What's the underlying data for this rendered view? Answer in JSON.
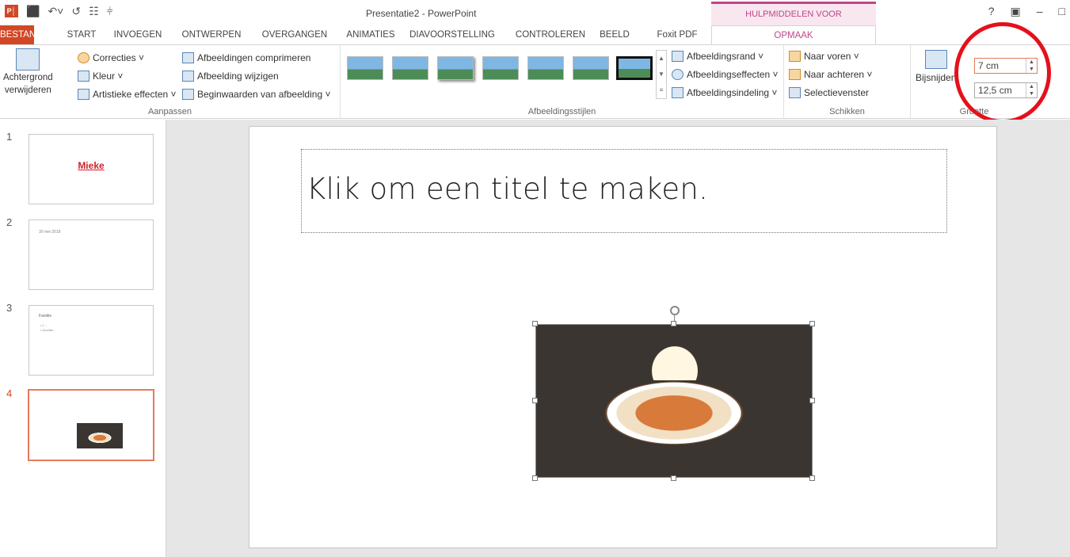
{
  "window": {
    "title": "Presentatie2 - PowerPoint",
    "context_tab_header": "HULPMIDDELEN VOOR AFBEELDINGEN",
    "help": "?",
    "restore_box": "▣",
    "minimize": "–",
    "maximize": "□"
  },
  "qat": {
    "app_icon": "P│",
    "save": "⬛",
    "undo": "↶˅",
    "redo": "↺",
    "touch": "☷",
    "more": "⫩"
  },
  "tabs": [
    "BESTAND",
    "START",
    "INVOEGEN",
    "ONTWERPEN",
    "OVERGANGEN",
    "ANIMATIES",
    "DIAVOORSTELLING",
    "CONTROLEREN",
    "BEELD",
    "Foxit PDF",
    "OPMAAK"
  ],
  "ribbon": {
    "aanpassen": {
      "label": "Aanpassen",
      "remove_bg_line1": "Achtergrond",
      "remove_bg_line2": "verwijderen",
      "correcties": "Correcties ˅",
      "kleur": "Kleur ˅",
      "artistieke": "Artistieke effecten ˅",
      "comprimeren": "Afbeeldingen comprimeren",
      "wijzigen": "Afbeelding wijzigen",
      "beginwaarden": "Beginwaarden van afbeelding ˅"
    },
    "stijlen": {
      "label": "Afbeeldingsstijlen",
      "rand": "Afbeeldingsrand ˅",
      "effecten": "Afbeeldingseffecten ˅",
      "indeling": "Afbeeldingsindeling ˅"
    },
    "schikken": {
      "label": "Schikken",
      "voren": "Naar voren ˅",
      "achteren": "Naar achteren ˅",
      "selectievenster": "Selectievenster"
    },
    "grootte": {
      "label": "Grootte",
      "bijsnijden": "Bijsnijden",
      "height": "7 cm",
      "width": "12,5 cm"
    }
  },
  "slides": [
    {
      "num": "1",
      "text": "Mieke"
    },
    {
      "num": "2",
      "text": "30 mei 2018"
    },
    {
      "num": "3",
      "text": "Familie"
    },
    {
      "num": "4",
      "text": ""
    }
  ],
  "slide3_bullets": [
    "• 1 ...",
    "• Dochter"
  ],
  "current_slide": {
    "title_placeholder": "Klik om een titel te maken."
  },
  "colors": {
    "accent": "#d24726",
    "context": "#c0458a",
    "annotation": "#e4111b"
  }
}
